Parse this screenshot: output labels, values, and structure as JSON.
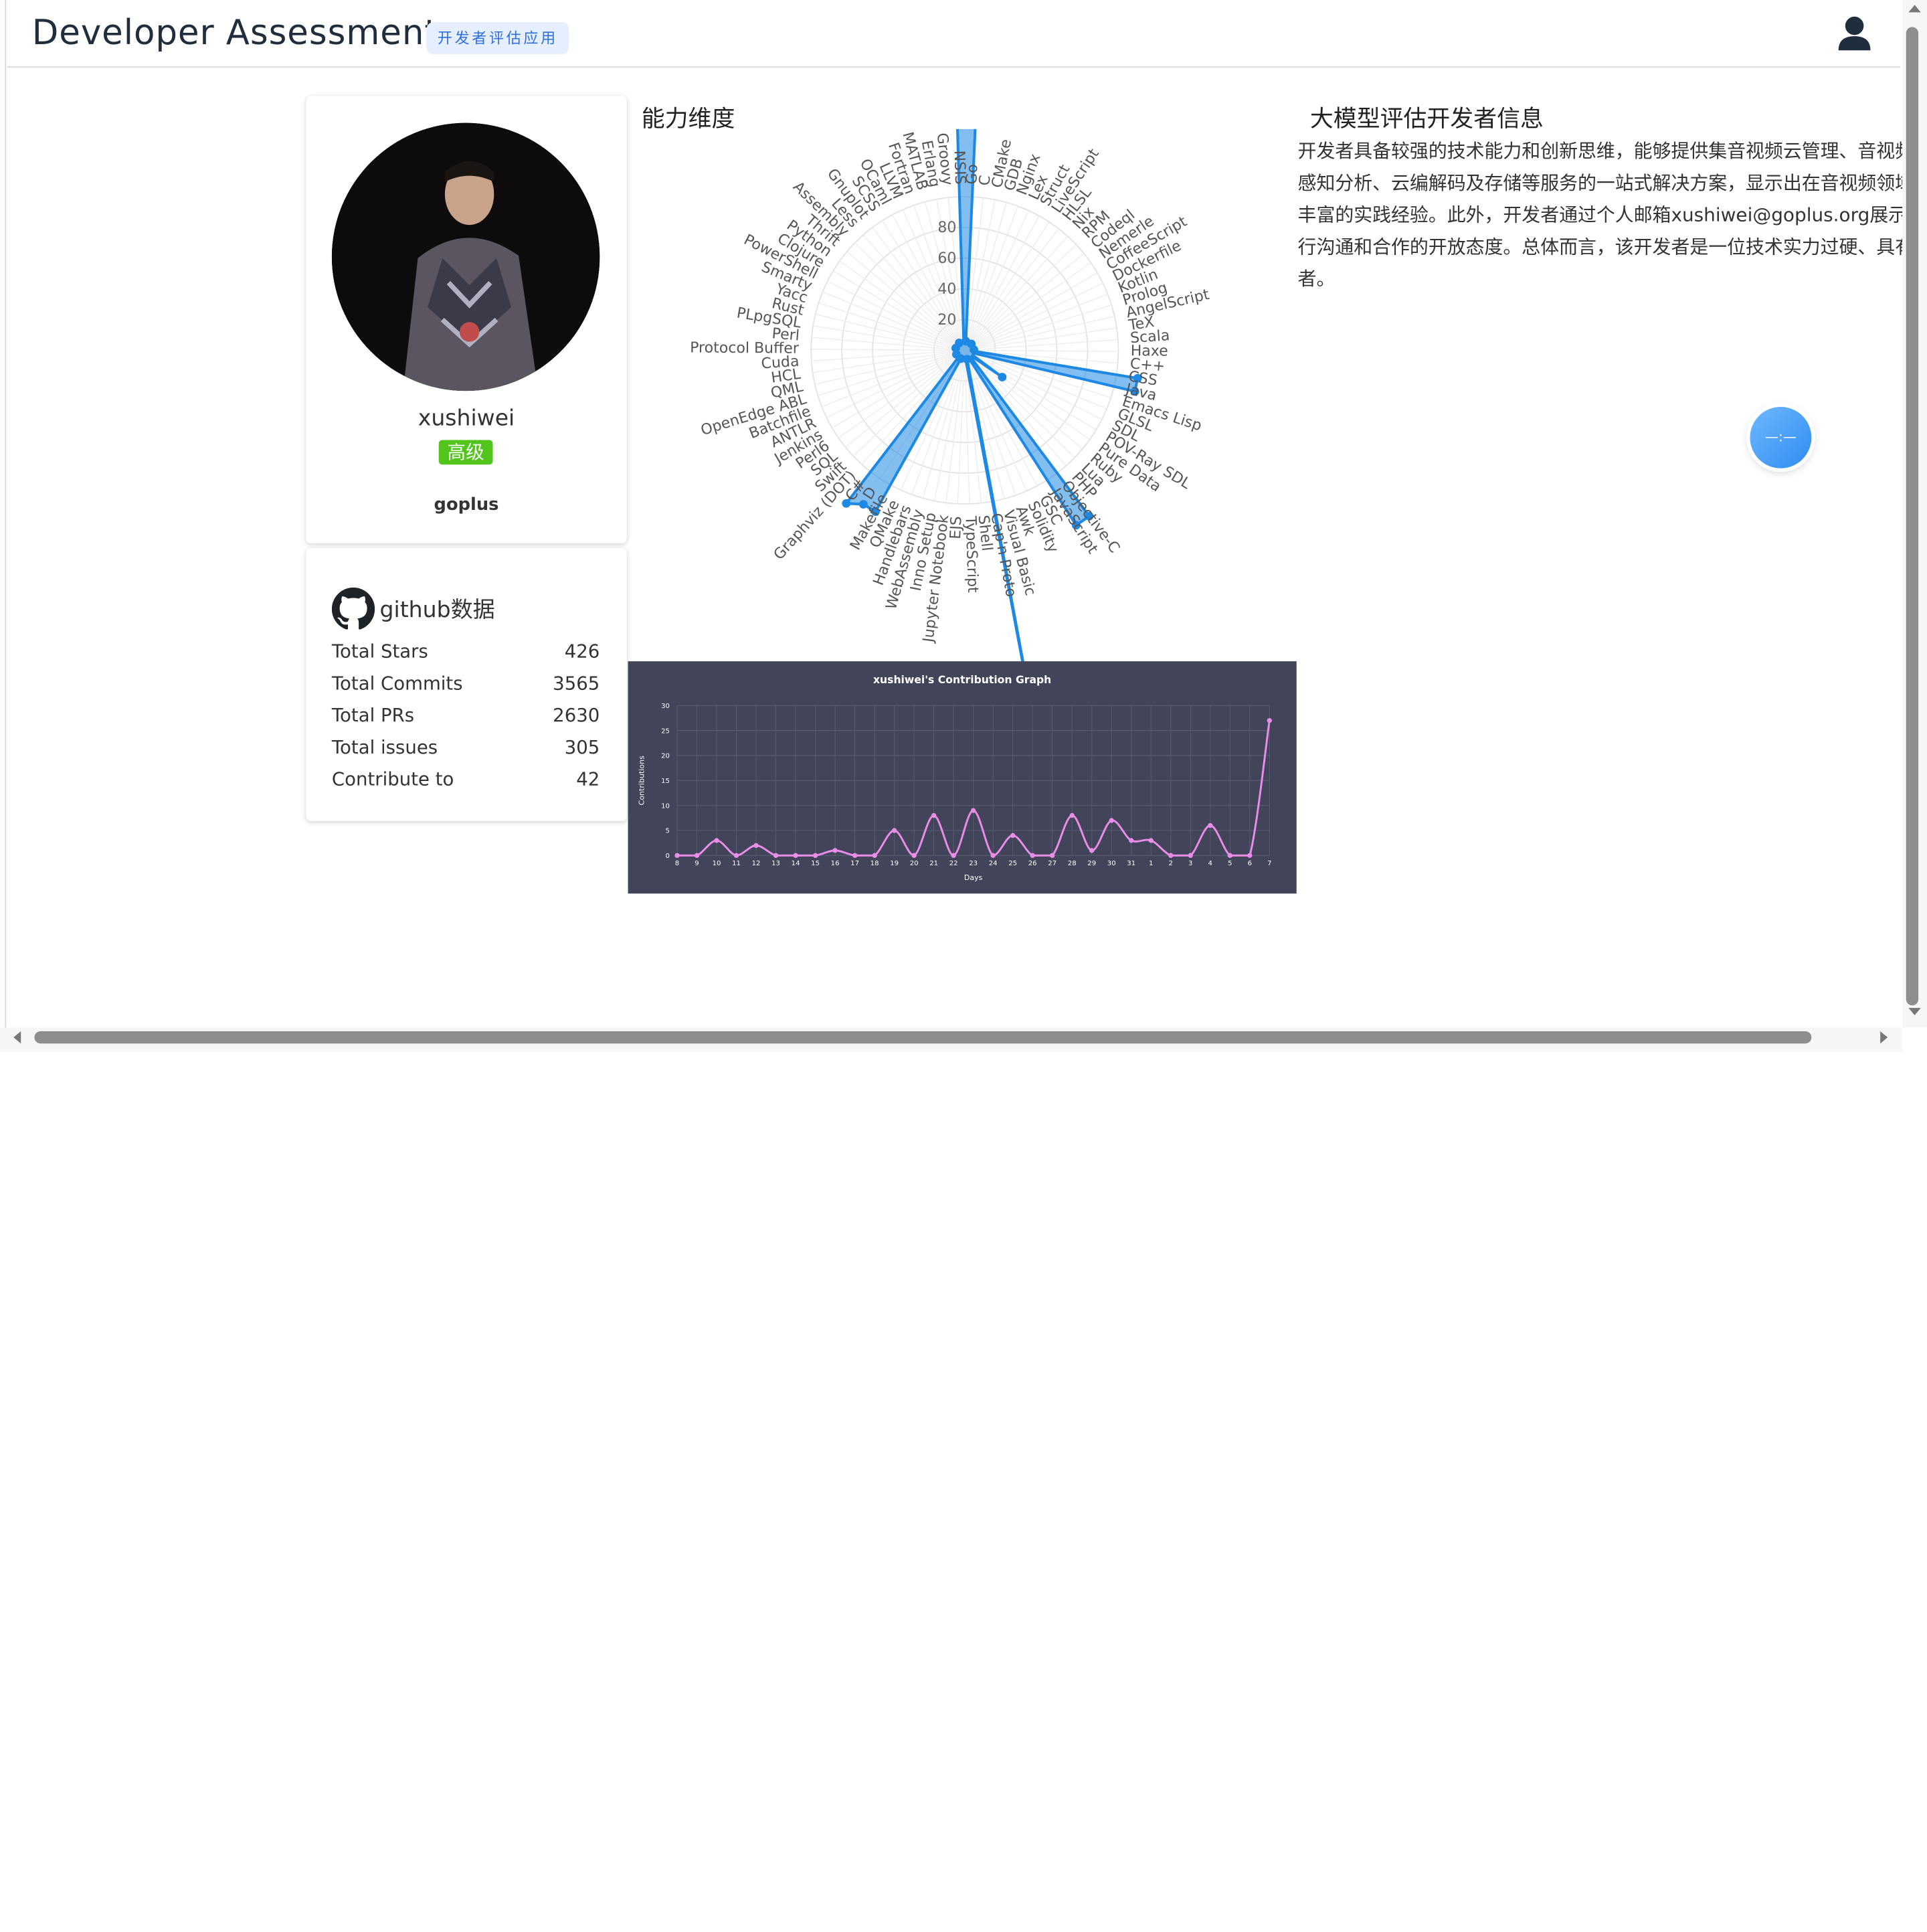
{
  "header": {
    "title": "Developer Assessment",
    "badge": "开发者评估应用"
  },
  "profile": {
    "username": "xushiwei",
    "level": "高级",
    "organization": "goplus"
  },
  "github": {
    "title": "github数据",
    "stats": [
      {
        "label": "Total Stars",
        "value": "426"
      },
      {
        "label": "Total Commits",
        "value": "3565"
      },
      {
        "label": "Total PRs",
        "value": "2630"
      },
      {
        "label": "Total issues",
        "value": "305"
      },
      {
        "label": "Contribute to",
        "value": "42"
      }
    ]
  },
  "radar_title": "能力维度",
  "assessment": {
    "title": "大模型评估开发者信息",
    "text": "开发者具备较强的技术能力和创新思维，能够提供集音视频云管理、音视频处理引擎、场景感知分析、云编解码及存储等服务的一站式解决方案，显示出在音视频领域有深入的研究和丰富的实践经验。此外，开发者通过个人邮箱xushiwei@goplus.org展示了其愿意与外界进行沟通和合作的开放态度。总体而言，该开发者是一位技术实力过硬、具有创新精神的开发者。"
  },
  "float_button": "—:—",
  "chart_data": [
    {
      "type": "radar",
      "title": "",
      "ticks": [
        "20",
        "40",
        "60",
        "80"
      ],
      "rmax": 100,
      "categories": [
        "C",
        "CMake",
        "GDB",
        "Nginx",
        "Lex",
        "Struct",
        "LiveScript",
        "HLSL",
        "Nix",
        "RPM",
        "Codeql",
        "Nemerle",
        "CoffeeScript",
        "Dockerfile",
        "Kotlin",
        "Prolog",
        "AngelScript",
        "TeX",
        "Scala",
        "Haxe",
        "C++",
        "CSS",
        "Java",
        "Emacs Lisp",
        "GLSL",
        "SDL",
        "POV-Ray SDL",
        "Pure Data",
        "Ruby",
        "Lua",
        "PHP",
        "Objective-C",
        "JavaScript",
        "GSC",
        "Solidity",
        "Awk",
        "Visual Basic",
        "Cap'n Proto",
        "Shell",
        "TypeScript",
        "EJS",
        "Jupyter Notebook",
        "Inno Setup",
        "WebAssembly",
        "Handlebars",
        "QMake",
        "Makefile",
        "D",
        "C#",
        "Graphviz (DOT)",
        "Swift",
        "SQL",
        "Perl6",
        "Jenkins",
        "ANTLR",
        "Batchfile",
        "OpenEdge ABL",
        "QML",
        "HCL",
        "Cuda",
        "Protocol Buffer",
        "Perl",
        "PLpgSQL",
        "Rust",
        "Yacc",
        "Smarty",
        "PowerShell",
        "Clojure",
        "Python",
        "Thrift",
        "Assembly",
        "Less",
        "Gnuplot",
        "SCSS",
        "OCaml",
        "LLVM",
        "Fortran",
        "MATLAB",
        "Erlang",
        "Groovy",
        "NSIS",
        "Go"
      ],
      "values": [
        2,
        2,
        1,
        2,
        2,
        2,
        2,
        2,
        2,
        2,
        2,
        2,
        2,
        2,
        2,
        2,
        2,
        2,
        2,
        2,
        2,
        38,
        38,
        2,
        2,
        2,
        2,
        10,
        2,
        2,
        2,
        45,
        45,
        2,
        2,
        2,
        2,
        100,
        2,
        2,
        2,
        2,
        2,
        2,
        2,
        2,
        40,
        40,
        42,
        2,
        2,
        2,
        2,
        2,
        2,
        2,
        2,
        2,
        2,
        2,
        2,
        2,
        2,
        2,
        2,
        2,
        2,
        2,
        2,
        2,
        2,
        2,
        2,
        2,
        2,
        2,
        2,
        2,
        2,
        2,
        100,
        100
      ]
    },
    {
      "type": "line",
      "title": "xushiwei's Contribution Graph",
      "xlabel": "Days",
      "ylabel": "Contributions",
      "ylim": [
        0,
        30
      ],
      "yticks": [
        "0",
        "5",
        "10",
        "15",
        "20",
        "25",
        "30"
      ],
      "x": [
        "8",
        "9",
        "10",
        "11",
        "12",
        "13",
        "14",
        "15",
        "16",
        "17",
        "18",
        "19",
        "20",
        "21",
        "22",
        "23",
        "24",
        "25",
        "26",
        "27",
        "28",
        "29",
        "30",
        "31",
        "1",
        "2",
        "3",
        "4",
        "5",
        "6",
        "7"
      ],
      "values": [
        0,
        0,
        3,
        0,
        2,
        0,
        0,
        0,
        1,
        0,
        0,
        5,
        0,
        8,
        0,
        9,
        0,
        4,
        0,
        0,
        8,
        1,
        7,
        3,
        3,
        0,
        0,
        6,
        0,
        0,
        27
      ],
      "colors": {
        "background": "#42445a",
        "line": "#e98de9",
        "grid": "#5a5d74"
      }
    }
  ]
}
